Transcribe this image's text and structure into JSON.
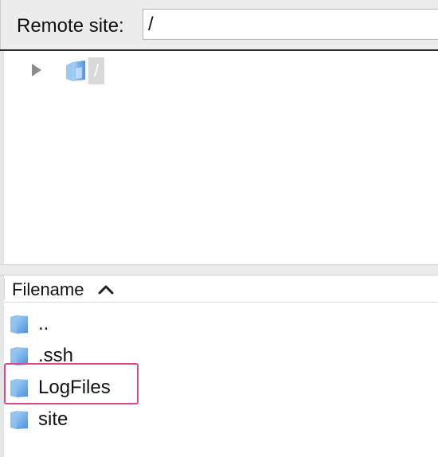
{
  "remote_site": {
    "label": "Remote site:",
    "value": "/"
  },
  "tree": {
    "root_label": "/",
    "toggle_icon": "disclosure-triangle-right-icon",
    "folder_icon": "folder-icon"
  },
  "file_list": {
    "column_header": "Filename",
    "sort_direction": "ascending",
    "sort_icon": "chevron-up-icon",
    "rows": [
      {
        "name": "..",
        "icon": "folder-icon"
      },
      {
        "name": ".ssh",
        "icon": "folder-icon"
      },
      {
        "name": "LogFiles",
        "icon": "folder-icon",
        "highlighted": true
      },
      {
        "name": "site",
        "icon": "folder-icon"
      }
    ]
  },
  "colors": {
    "highlight_border": "#e0467f",
    "folder_blue": "#5aa0e6"
  }
}
